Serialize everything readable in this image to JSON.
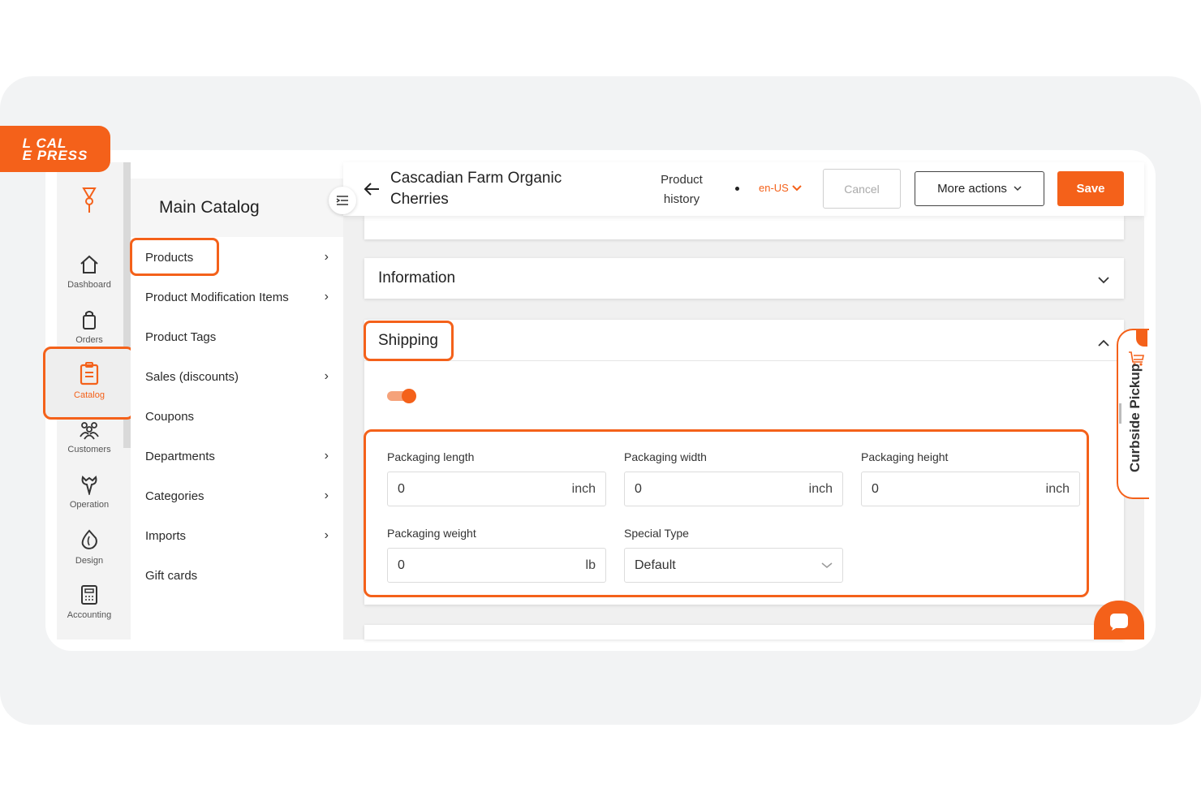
{
  "brand": {
    "logo_text_line1": "L CAL",
    "logo_text_line2": "E PRESS",
    "accent": "#f4611a"
  },
  "rail": {
    "items": [
      {
        "label": "Dashboard",
        "icon": "home-icon"
      },
      {
        "label": "Orders",
        "icon": "bag-icon"
      },
      {
        "label": "Catalog",
        "icon": "clipboard-icon",
        "active": true
      },
      {
        "label": "Customers",
        "icon": "users-icon"
      },
      {
        "label": "Operation",
        "icon": "wrench-icon"
      },
      {
        "label": "Design",
        "icon": "drop-icon"
      },
      {
        "label": "Accounting",
        "icon": "calculator-icon"
      }
    ]
  },
  "catalog": {
    "title": "Main Catalog",
    "items": [
      {
        "label": "Products",
        "chevron": true
      },
      {
        "label": "Product Modification Items",
        "chevron": true
      },
      {
        "label": "Product Tags",
        "chevron": false
      },
      {
        "label": "Sales (discounts)",
        "chevron": true
      },
      {
        "label": "Coupons",
        "chevron": false
      },
      {
        "label": "Departments",
        "chevron": true
      },
      {
        "label": "Categories",
        "chevron": true
      },
      {
        "label": "Imports",
        "chevron": true
      },
      {
        "label": "Gift cards",
        "chevron": false
      }
    ]
  },
  "header": {
    "product_title": "Cascadian Farm Organic Cherries",
    "history_line1": "Product",
    "history_line2": "history",
    "locale": "en-US",
    "cancel_label": "Cancel",
    "more_actions_label": "More actions",
    "save_label": "Save"
  },
  "sections": {
    "information_title": "Information",
    "shipping_title": "Shipping",
    "shipping_enabled": true
  },
  "shipping_fields": {
    "length": {
      "label": "Packaging length",
      "value": "0",
      "unit": "inch"
    },
    "width": {
      "label": "Packaging width",
      "value": "0",
      "unit": "inch"
    },
    "height": {
      "label": "Packaging height",
      "value": "0",
      "unit": "inch"
    },
    "weight": {
      "label": "Packaging weight",
      "value": "0",
      "unit": "lb"
    },
    "special_type": {
      "label": "Special Type",
      "value": "Default"
    }
  },
  "curbside": {
    "label": "Curbside Pickup"
  }
}
